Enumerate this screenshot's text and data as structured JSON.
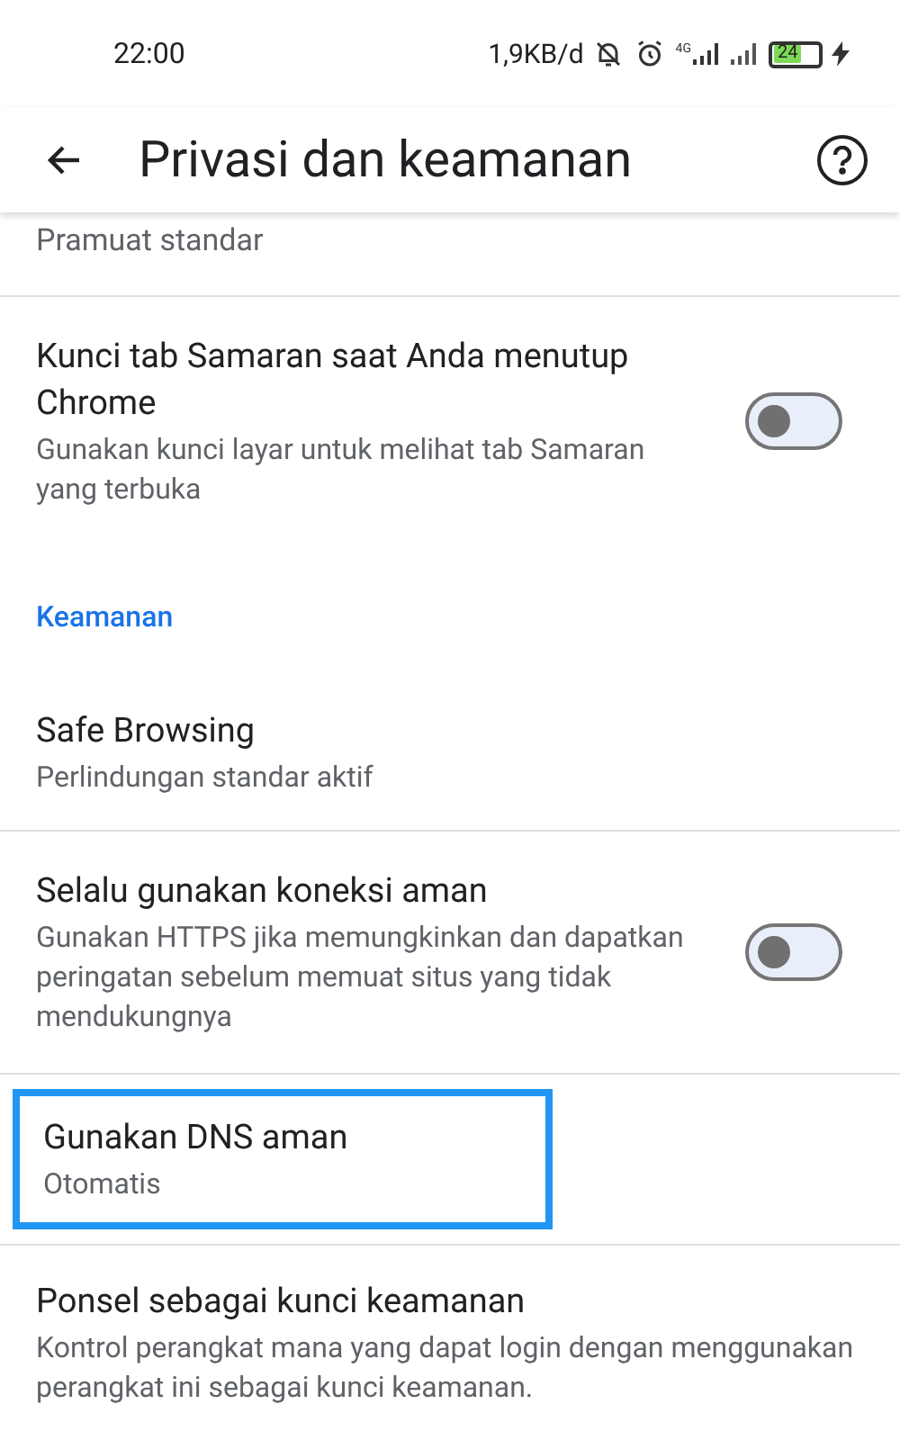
{
  "status_bar": {
    "time": "22:00",
    "network_speed": "1,9KB/d",
    "network_type": "4G",
    "battery": "24"
  },
  "app_bar": {
    "title": "Privasi dan keamanan"
  },
  "items": [
    {
      "kind": "subtitle",
      "subtitle": "Pramuat standar",
      "divider": true
    },
    {
      "kind": "toggle",
      "title": "Kunci tab Samaran saat Anda menutup Chrome",
      "subtitle": "Gunakan kunci layar untuk melihat tab Samaran yang terbuka",
      "on": false,
      "divider": false
    },
    {
      "kind": "header",
      "title": "Keamanan"
    },
    {
      "kind": "item",
      "title": "Safe Browsing",
      "subtitle": "Perlindungan standar aktif",
      "divider": true,
      "highlighted": false
    },
    {
      "kind": "toggle",
      "title": "Selalu gunakan koneksi aman",
      "subtitle": "Gunakan HTTPS jika memungkinkan dan dapatkan peringatan sebelum memuat situs yang tidak mendukungnya",
      "on": false,
      "divider": true
    },
    {
      "kind": "item",
      "title": "Gunakan DNS aman",
      "subtitle": "Otomatis",
      "divider": true,
      "highlighted": true
    },
    {
      "kind": "item",
      "title": "Ponsel sebagai kunci keamanan",
      "subtitle": "Kontrol perangkat mana yang dapat login dengan menggunakan perangkat ini sebagai kunci keamanan.",
      "divider": false,
      "highlighted": false
    }
  ]
}
